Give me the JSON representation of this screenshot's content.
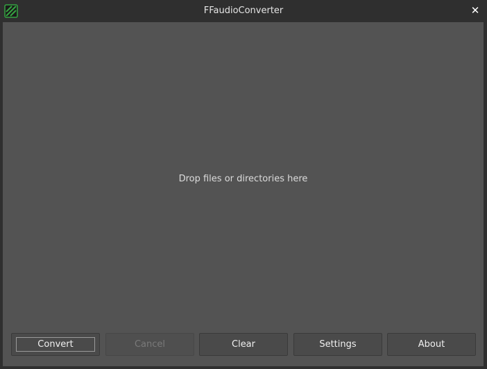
{
  "window": {
    "title": "FFaudioConverter",
    "close_glyph": "✕",
    "app_icon": "ffaudioconverter-logo-icon",
    "accent_color": "#35a442"
  },
  "drop_zone": {
    "text": "Drop files or directories here"
  },
  "buttons": {
    "convert": {
      "label": "Convert",
      "enabled": true,
      "focused": true
    },
    "cancel": {
      "label": "Cancel",
      "enabled": false
    },
    "clear": {
      "label": "Clear",
      "enabled": true
    },
    "settings": {
      "label": "Settings",
      "enabled": true
    },
    "about": {
      "label": "About",
      "enabled": true
    }
  }
}
